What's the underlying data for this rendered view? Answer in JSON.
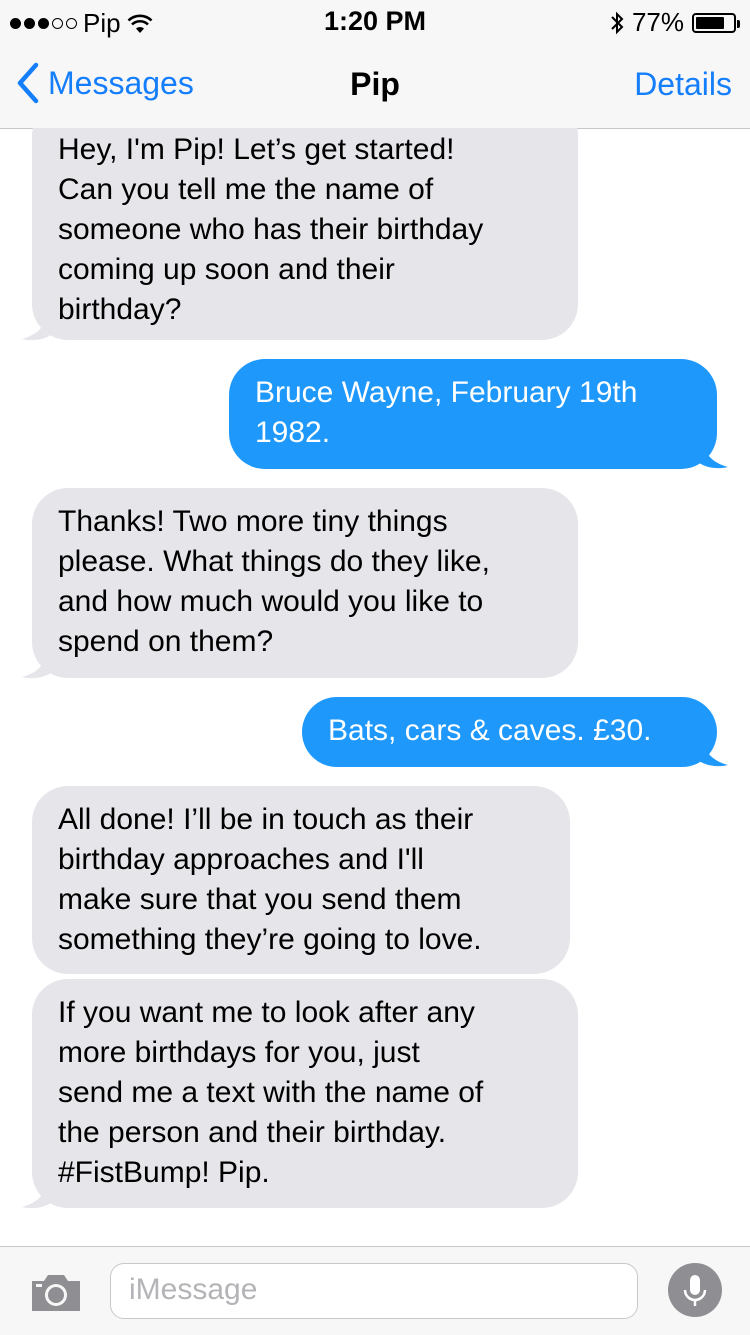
{
  "status": {
    "carrier": "Pip",
    "time": "1:20 PM",
    "battery": "77%",
    "battery_level": 0.77,
    "signal_bars_filled": 3,
    "signal_bars_total": 5
  },
  "nav": {
    "back_label": "Messages",
    "title": "Pip",
    "details_label": "Details"
  },
  "messages": [
    {
      "from": "contact",
      "text": "Hey, I'm Pip! Let’s get started!\nCan you tell me the name of\nsomeone who has their birthday\ncoming up soon and their\nbirthday?"
    },
    {
      "from": "me",
      "text": "Bruce Wayne, February 19th\n1982."
    },
    {
      "from": "contact",
      "text": "Thanks! Two more tiny things\nplease. What things do they like,\nand how much would you like to\nspend on them?"
    },
    {
      "from": "me",
      "text": "Bats, cars & caves. £30."
    },
    {
      "from": "contact",
      "text": "All done! I’ll be in touch as their\nbirthday approaches and I'll\nmake sure that you send them\nsomething they’re going to love."
    },
    {
      "from": "contact",
      "text": "If you want me to look after any\nmore birthdays for you, just\nsend me a text with the name of\nthe person and their birthday.\n#FistBump! Pip."
    }
  ],
  "input": {
    "placeholder": "iMessage"
  },
  "colors": {
    "accent": "#147efb",
    "outgoing_bubble": "#1e98fb",
    "incoming_bubble": "#e5e5ea"
  },
  "icons": {
    "back": "chevron-left-icon",
    "camera": "camera-icon",
    "microphone": "microphone-icon",
    "bluetooth": "bluetooth-icon",
    "wifi": "wifi-icon"
  }
}
